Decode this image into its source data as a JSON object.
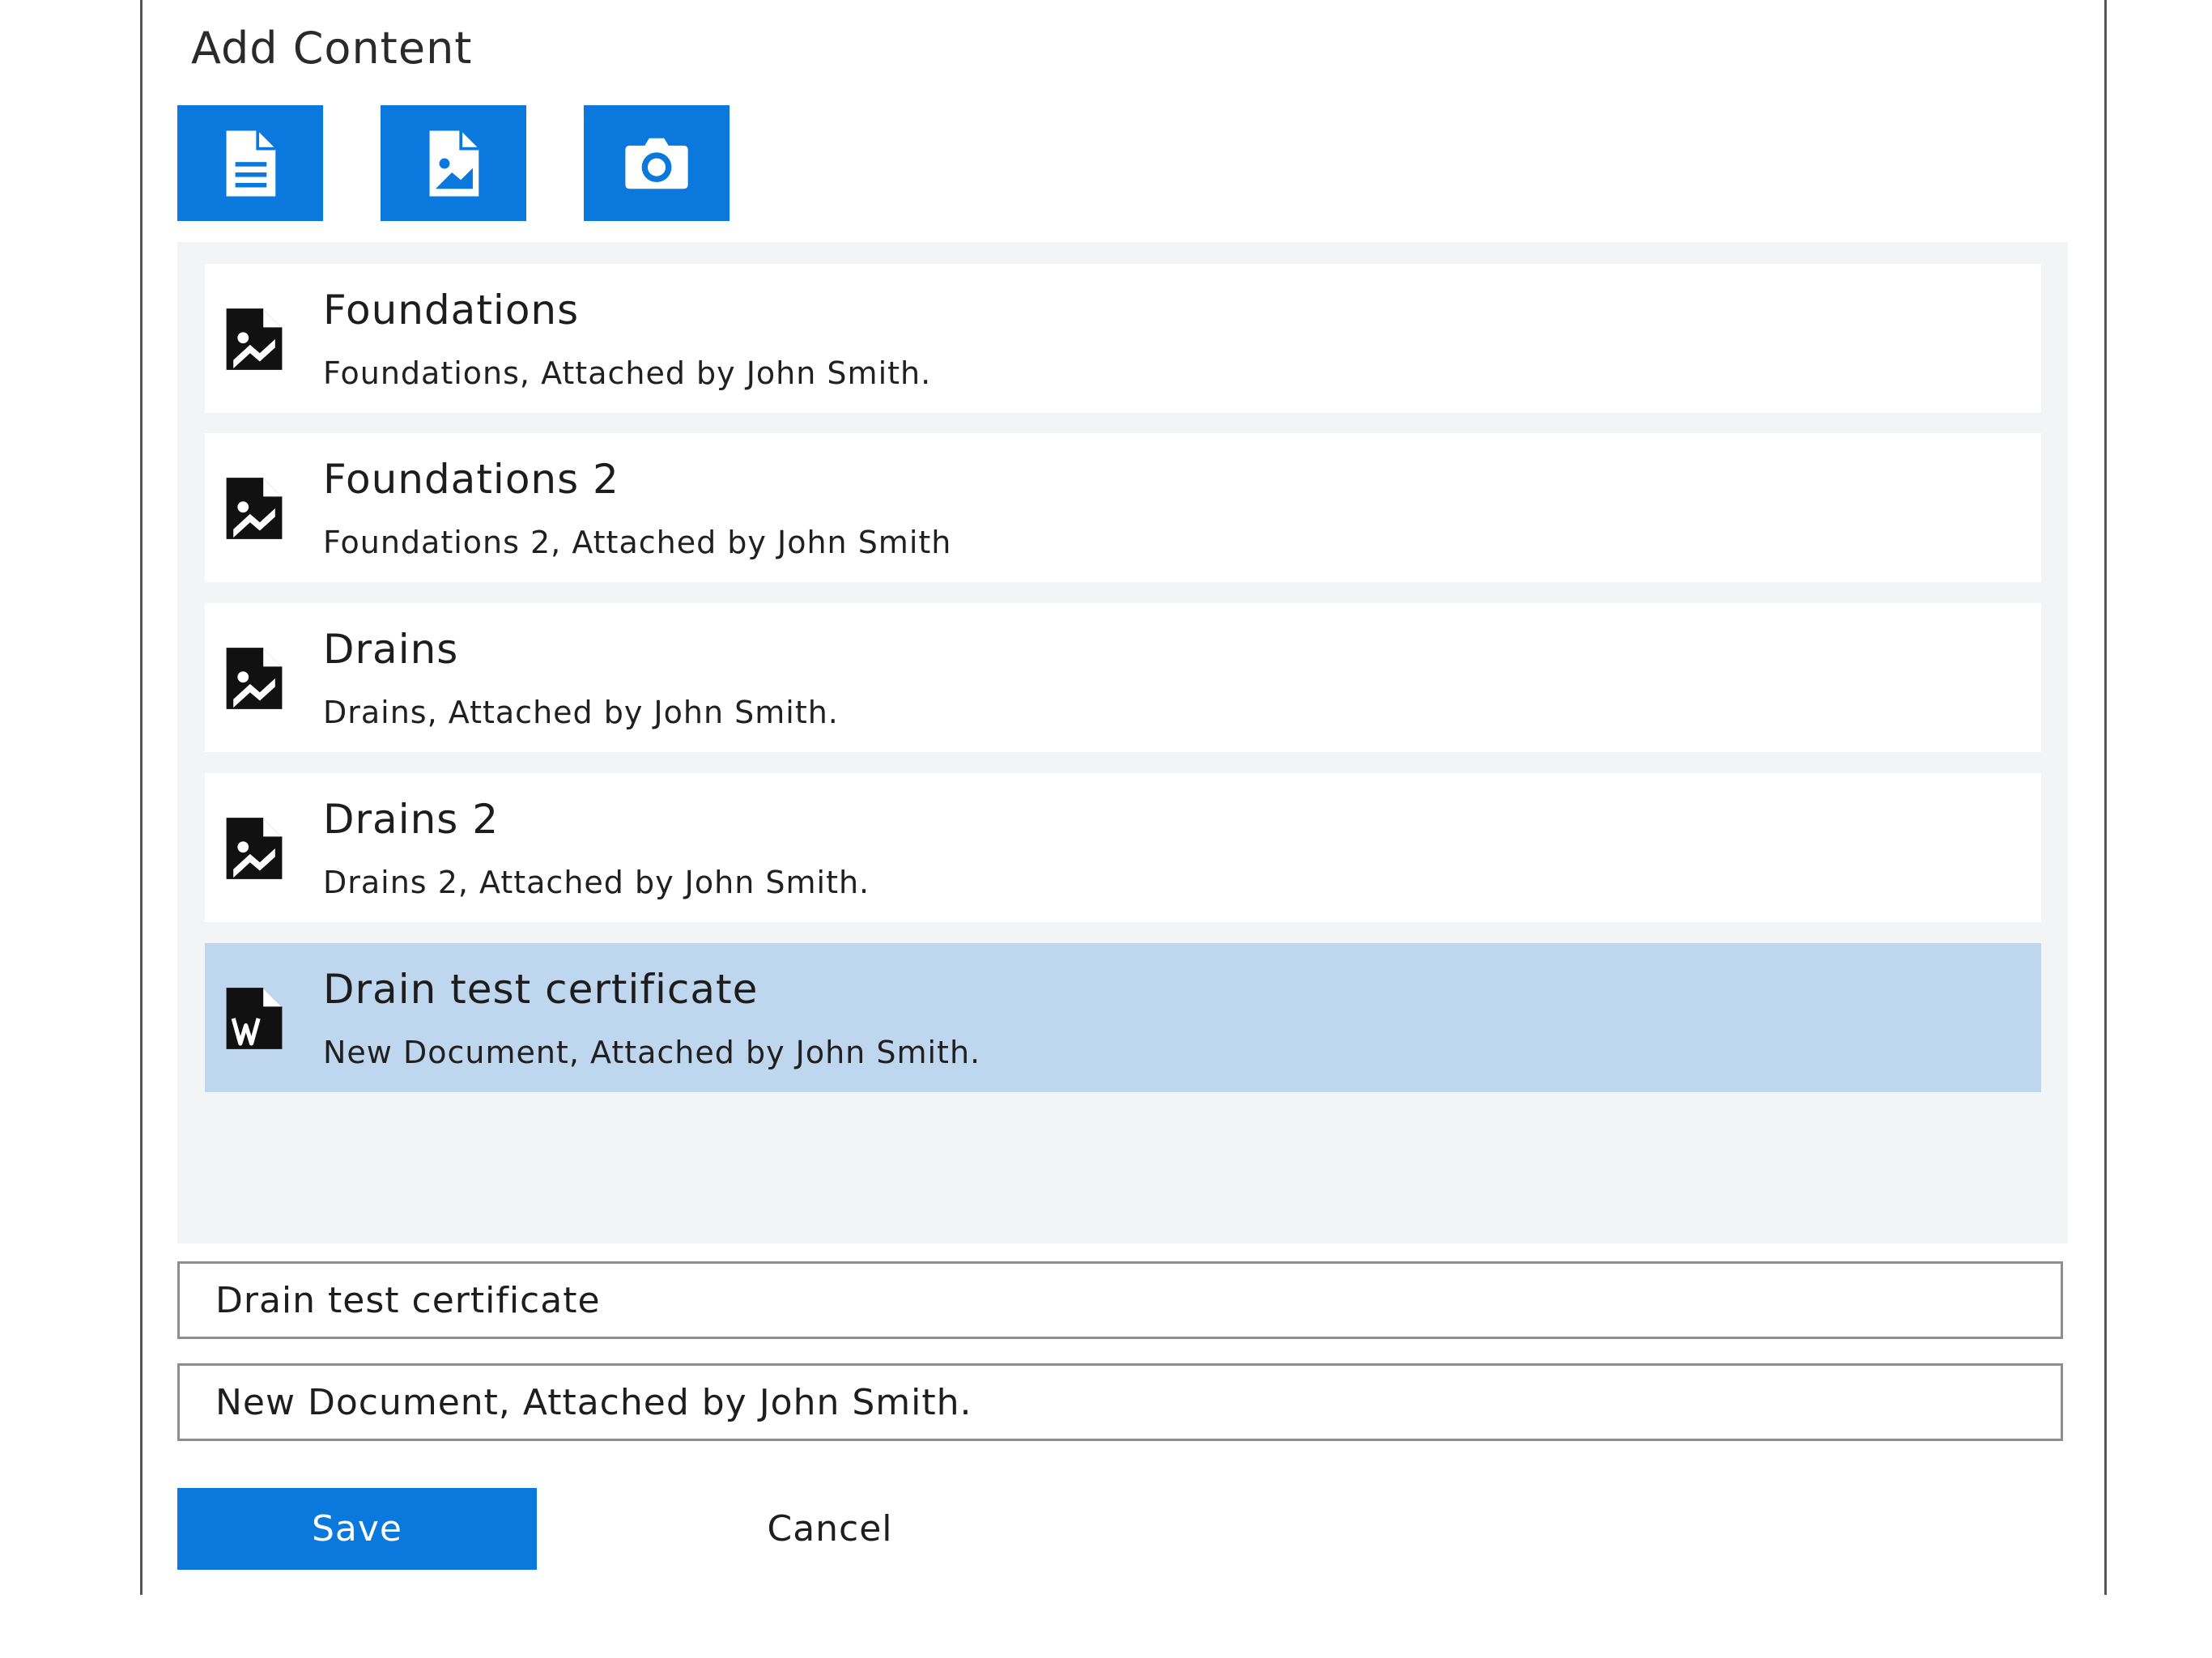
{
  "panel": {
    "title": "Add Content"
  },
  "toolbar": {
    "buttons": [
      {
        "icon": "document-icon"
      },
      {
        "icon": "image-icon"
      },
      {
        "icon": "camera-icon"
      }
    ]
  },
  "attachments": [
    {
      "title": "Foundations",
      "subtitle": "Foundations, Attached by John Smith.",
      "icon": "image-file-icon",
      "selected": false
    },
    {
      "title": "Foundations 2",
      "subtitle": "Foundations 2, Attached by John Smith",
      "icon": "image-file-icon",
      "selected": false
    },
    {
      "title": "Drains",
      "subtitle": "Drains, Attached by John Smith.",
      "icon": "image-file-icon",
      "selected": false
    },
    {
      "title": "Drains 2",
      "subtitle": "Drains 2, Attached by John Smith.",
      "icon": "image-file-icon",
      "selected": false
    },
    {
      "title": "Drain test certificate",
      "subtitle": "New Document, Attached by John Smith.",
      "icon": "word-document-icon",
      "selected": true
    }
  ],
  "form": {
    "title_value": "Drain test certificate",
    "description_value": "New Document, Attached by John Smith."
  },
  "actions": {
    "save_label": "Save",
    "cancel_label": "Cancel"
  },
  "colors": {
    "accent": "#0a78dc",
    "selected_row": "#bed6ee",
    "list_background": "#f3f4f6",
    "border": "#8e8e8e"
  }
}
